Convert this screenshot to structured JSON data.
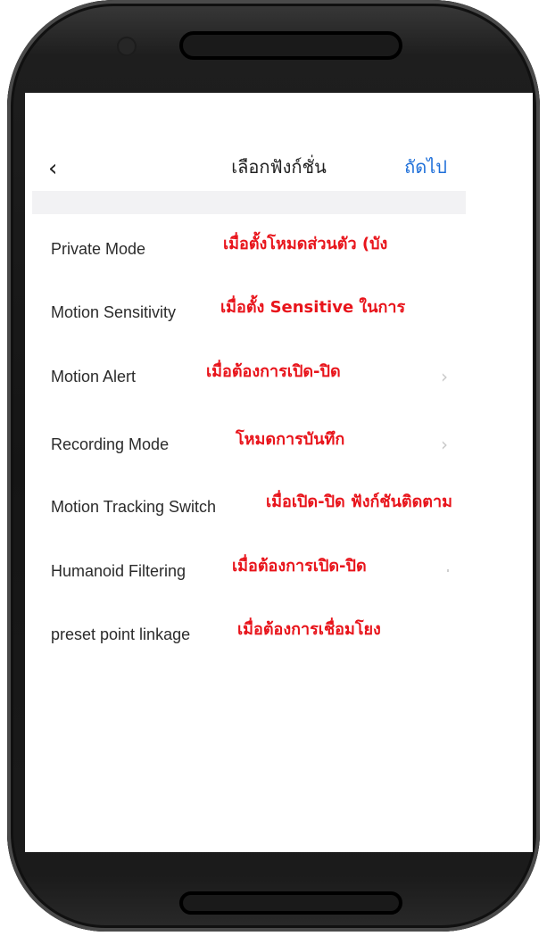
{
  "header": {
    "title": "เลือกฟังก์ชั่น",
    "next_label": "ถัดไป"
  },
  "rows": [
    {
      "label": "Private Mode",
      "note": "เมื่อตั้งโหมดส่วนตัว (บัง"
    },
    {
      "label": "Motion Sensitivity",
      "note": "เมื่อตั้ง Sensitive ในการ"
    },
    {
      "label": "Motion Alert",
      "note": "เมื่อต้องการเปิด-ปิด"
    },
    {
      "label": "Recording Mode",
      "note": "โหมดการบันทึก"
    },
    {
      "label": "Motion Tracking Switch",
      "note": "เมื่อเปิด-ปิด ฟังก์ชันติดตาม"
    },
    {
      "label": "Humanoid Filtering",
      "note": "เมื่อต้องการเปิด-ปิด"
    },
    {
      "label": "preset point linkage",
      "note": "เมื่อต้องการเชื่อมโยง"
    }
  ],
  "colors": {
    "accent": "#1e6fd9",
    "annotation": "#e8141b"
  }
}
